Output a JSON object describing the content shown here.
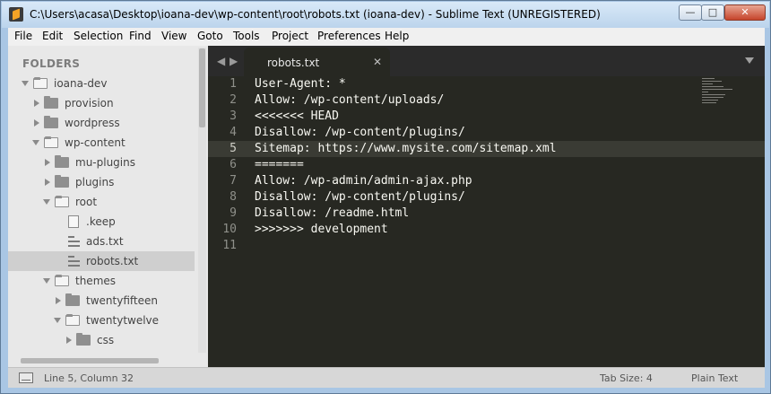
{
  "window": {
    "title": "C:\\Users\\acasa\\Desktop\\ioana-dev\\wp-content\\root\\robots.txt (ioana-dev) - Sublime Text (UNREGISTERED)",
    "minimize": "—",
    "maximize": "□",
    "close": "✕"
  },
  "menu": [
    "File",
    "Edit",
    "Selection",
    "Find",
    "View",
    "Goto",
    "Tools",
    "Project",
    "Preferences",
    "Help"
  ],
  "sidebar": {
    "title": "FOLDERS",
    "items": [
      {
        "label": "ioana-dev",
        "type": "folder",
        "state": "open"
      },
      {
        "label": "provision",
        "type": "folder",
        "state": "closed"
      },
      {
        "label": "wordpress",
        "type": "folder",
        "state": "closed"
      },
      {
        "label": "wp-content",
        "type": "folder",
        "state": "open"
      },
      {
        "label": "mu-plugins",
        "type": "folder",
        "state": "closed"
      },
      {
        "label": "plugins",
        "type": "folder",
        "state": "closed"
      },
      {
        "label": "root",
        "type": "folder",
        "state": "open"
      },
      {
        "label": ".keep",
        "type": "file"
      },
      {
        "label": "ads.txt",
        "type": "text-file"
      },
      {
        "label": "robots.txt",
        "type": "text-file",
        "selected": true
      },
      {
        "label": "themes",
        "type": "folder",
        "state": "open"
      },
      {
        "label": "twentyfifteen",
        "type": "folder",
        "state": "closed"
      },
      {
        "label": "twentytwelve",
        "type": "folder",
        "state": "open"
      },
      {
        "label": "css",
        "type": "folder",
        "state": "closed"
      }
    ]
  },
  "tabs": {
    "nav_left": "◀",
    "nav_right": "▶",
    "active_label": "robots.txt",
    "close": "✕"
  },
  "editor": {
    "current_line": 5,
    "lines": [
      "User-Agent: *",
      "Allow: /wp-content/uploads/",
      "<<<<<<< HEAD",
      "Disallow: /wp-content/plugins/",
      "Sitemap: https://www.mysite.com/sitemap.xml",
      "=======",
      "Allow: /wp-admin/admin-ajax.php",
      "Disallow: /wp-content/plugins/",
      "Disallow: /readme.html",
      ">>>>>>> development",
      ""
    ]
  },
  "status": {
    "position": "Line 5, Column 32",
    "tab_size": "Tab Size: 4",
    "syntax": "Plain Text"
  }
}
